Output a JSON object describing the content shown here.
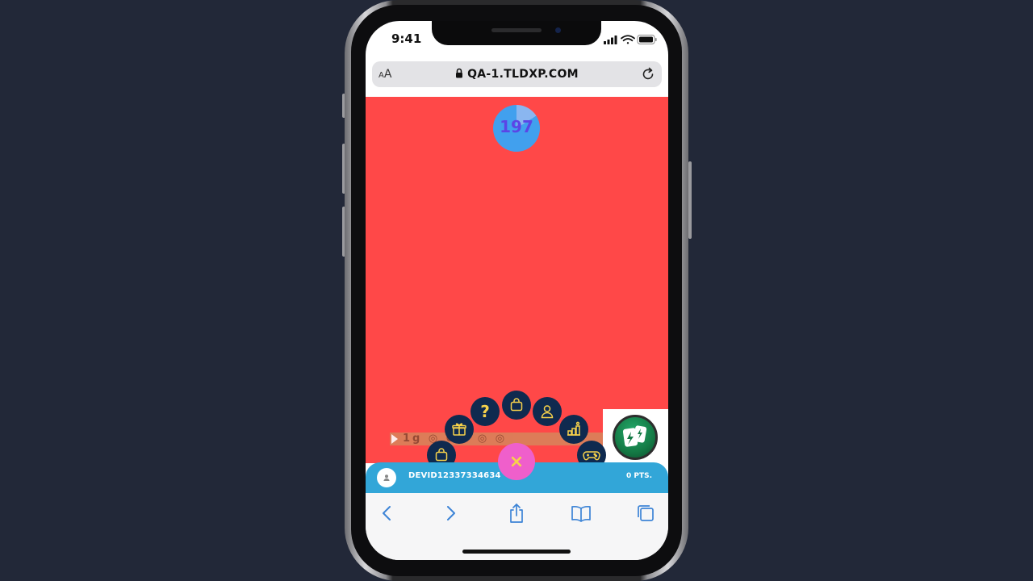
{
  "status_bar": {
    "time": "9:41"
  },
  "browser": {
    "text_size_label": "AA",
    "url": "QA-1.TLDXP.COM"
  },
  "game": {
    "timer_value": "197",
    "timer_progress": 0.84,
    "background_color": "#ff4848",
    "strip_text": "1g ◎ 0 0 ◎ ◎"
  },
  "radial_menu": {
    "items": [
      {
        "icon": "shopping-bag-icon"
      },
      {
        "icon": "gift-icon"
      },
      {
        "icon": "help-icon",
        "label": "?"
      },
      {
        "icon": "shopping-bag-icon"
      },
      {
        "icon": "user-icon"
      },
      {
        "icon": "leaderboard-icon"
      },
      {
        "icon": "gamepad-icon"
      }
    ],
    "close_label": "×",
    "accent_color": "#f7d24b",
    "button_color": "#0f2a4f",
    "fab_color": "#ef5fcb"
  },
  "player": {
    "name": "DEVID12337334634",
    "points": "0 PTS."
  },
  "colors": {
    "player_bar": "#32a6d8",
    "page_background": "#222838"
  }
}
